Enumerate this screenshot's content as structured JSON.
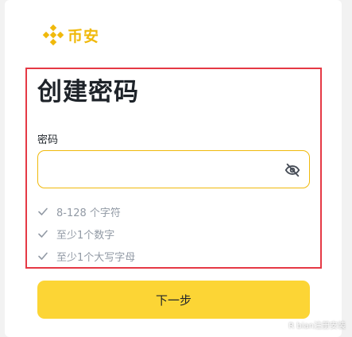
{
  "brand": {
    "name": "币安",
    "color": "#F0B90B"
  },
  "page": {
    "title": "创建密码"
  },
  "password": {
    "label": "密码",
    "value": "",
    "placeholder": ""
  },
  "rules": [
    {
      "label": "8-128 个字符"
    },
    {
      "label": "至少1个数字"
    },
    {
      "label": "至少1个大写字母"
    }
  ],
  "actions": {
    "next_label": "下一步",
    "button_color": "#FCD535"
  },
  "watermark": {
    "text": "R bian注册安装"
  },
  "highlight_color": "#e53945"
}
